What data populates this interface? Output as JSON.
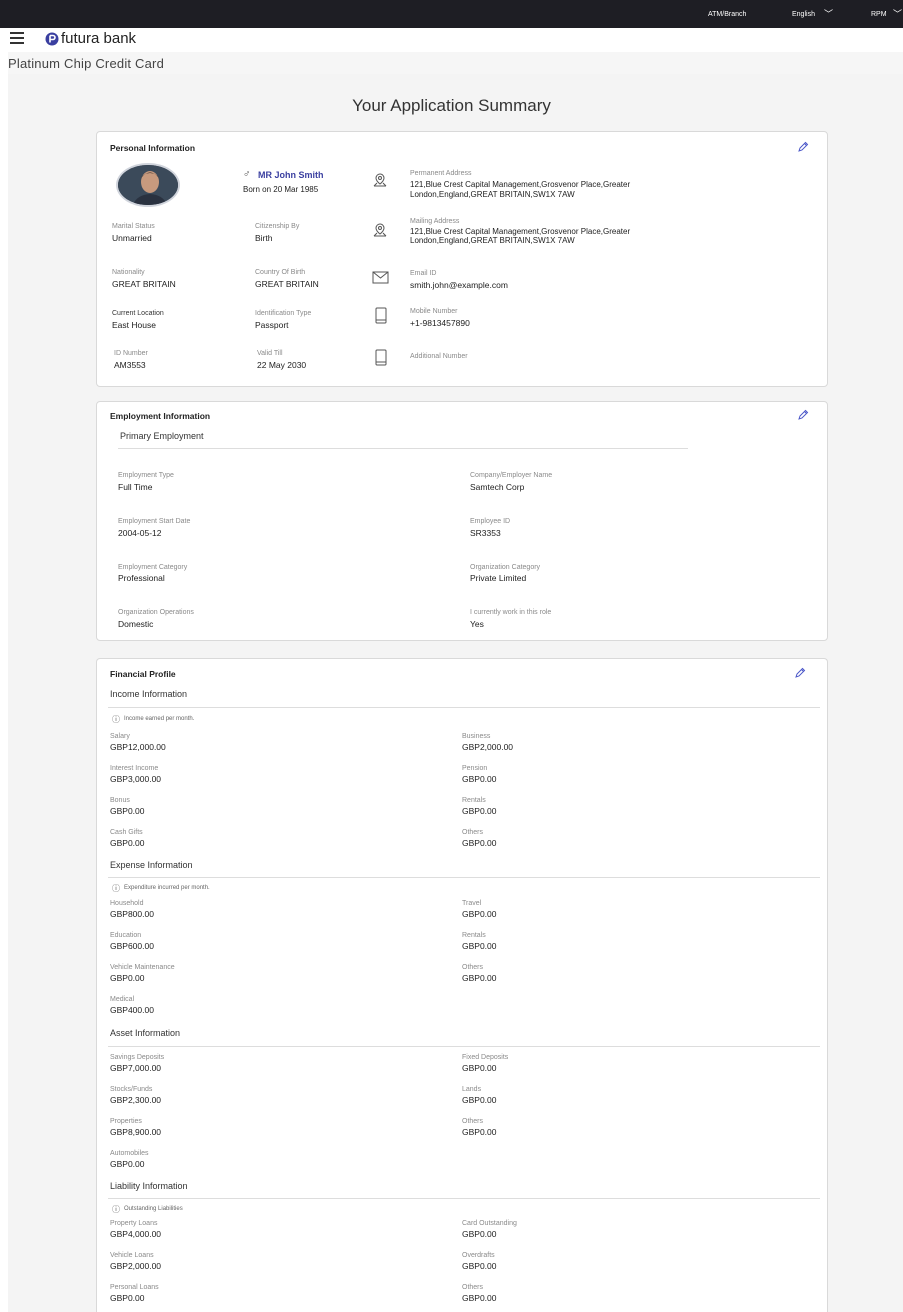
{
  "topbar": {
    "atm": "ATM/Branch",
    "language": "English",
    "user": "RPM"
  },
  "brand": {
    "name": "futura bank"
  },
  "page": {
    "subtitle": "Platinum Chip Credit Card",
    "title": "Your Application Summary"
  },
  "personal": {
    "title": "Personal Information",
    "name": "MR John Smith",
    "born": "Born on 20 Mar 1985",
    "marital_label": "Marital Status",
    "marital_value": "Unmarried",
    "citizenship_label": "Citizenship By",
    "citizenship_value": "Birth",
    "nationality_label": "Nationality",
    "nationality_value": "GREAT BRITAIN",
    "cob_label": "Country Of Birth",
    "cob_value": "GREAT BRITAIN",
    "location_label": "Current Location",
    "location_value": "East House",
    "idtype_label": "Identification Type",
    "idtype_value": "Passport",
    "idnum_label": "ID Number",
    "idnum_value": "AM3553",
    "valid_label": "Valid Till",
    "valid_value": "22 May 2030",
    "perm_label": "Permanent Address",
    "perm_line1": "121,Blue Crest Capital Management,Grosvenor Place,Greater",
    "perm_line2": "London,England,GREAT BRITAIN,SW1X 7AW",
    "mail_label": "Mailing Address",
    "mail_line1": "121,Blue Crest Capital Management,Grosvenor Place,Greater",
    "mail_line2": "London,England,GREAT BRITAIN,SW1X 7AW",
    "email_label": "Email ID",
    "email_value": "smith.john@example.com",
    "mobile_label": "Mobile Number",
    "mobile_value": "+1-9813457890",
    "additional_label": "Additional Number"
  },
  "employment": {
    "title": "Employment Information",
    "primary": "Primary Employment",
    "type_label": "Employment Type",
    "type_value": "Full Time",
    "company_label": "Company/Employer Name",
    "company_value": "Samtech Corp",
    "start_label": "Employment Start Date",
    "start_value": "2004-05-12",
    "empid_label": "Employee ID",
    "empid_value": "SR3353",
    "cat_label": "Employment Category",
    "cat_value": "Professional",
    "orgcat_label": "Organization Category",
    "orgcat_value": "Private Limited",
    "ops_label": "Organization Operations",
    "ops_value": "Domestic",
    "current_label": "I currently work in this role",
    "current_value": "Yes"
  },
  "financial": {
    "title": "Financial Profile",
    "income": {
      "title": "Income Information",
      "note": "Income earned per month.",
      "salary_label": "Salary",
      "salary_value": "GBP12,000.00",
      "business_label": "Business",
      "business_value": "GBP2,000.00",
      "interest_label": "Interest Income",
      "interest_value": "GBP3,000.00",
      "pension_label": "Pension",
      "pension_value": "GBP0.00",
      "bonus_label": "Bonus",
      "bonus_value": "GBP0.00",
      "rentals_label": "Rentals",
      "rentals_value": "GBP0.00",
      "gifts_label": "Cash Gifts",
      "gifts_value": "GBP0.00",
      "others_label": "Others",
      "others_value": "GBP0.00"
    },
    "expense": {
      "title": "Expense Information",
      "note": "Expenditure incurred per month.",
      "household_label": "Household",
      "household_value": "GBP800.00",
      "travel_label": "Travel",
      "travel_value": "GBP0.00",
      "education_label": "Education",
      "education_value": "GBP600.00",
      "rentals_label": "Rentals",
      "rentals_value": "GBP0.00",
      "vehicle_label": "Vehicle Maintenance",
      "vehicle_value": "GBP0.00",
      "others_label": "Others",
      "others_value": "GBP0.00",
      "medical_label": "Medical",
      "medical_value": "GBP400.00"
    },
    "asset": {
      "title": "Asset Information",
      "savings_label": "Savings Deposits",
      "savings_value": "GBP7,000.00",
      "fixed_label": "Fixed Deposits",
      "fixed_value": "GBP0.00",
      "stocks_label": "Stocks/Funds",
      "stocks_value": "GBP2,300.00",
      "lands_label": "Lands",
      "lands_value": "GBP0.00",
      "properties_label": "Properties",
      "properties_value": "GBP8,900.00",
      "others_label": "Others",
      "others_value": "GBP0.00",
      "auto_label": "Automobiles",
      "auto_value": "GBP0.00"
    },
    "liability": {
      "title": "Liability Information",
      "note": "Outstanding Liabilities",
      "property_label": "Property Loans",
      "property_value": "GBP4,000.00",
      "card_label": "Card Outstanding",
      "card_value": "GBP0.00",
      "vehicle_label": "Vehicle Loans",
      "vehicle_value": "GBP2,000.00",
      "overdrafts_label": "Overdrafts",
      "overdrafts_value": "GBP0.00",
      "personal_label": "Personal Loans",
      "personal_value": "GBP0.00",
      "others_label": "Others",
      "others_value": "GBP0.00"
    }
  },
  "colors": {
    "topbar": "#1e1e24",
    "accent": "#3a3fa0",
    "edit": "#4a56c8"
  },
  "icons": [
    "menu-icon",
    "logo-icon",
    "caret-down-icon",
    "edit-icon",
    "location-icon",
    "mail-icon",
    "phone-icon",
    "info-icon",
    "male-icon"
  ]
}
